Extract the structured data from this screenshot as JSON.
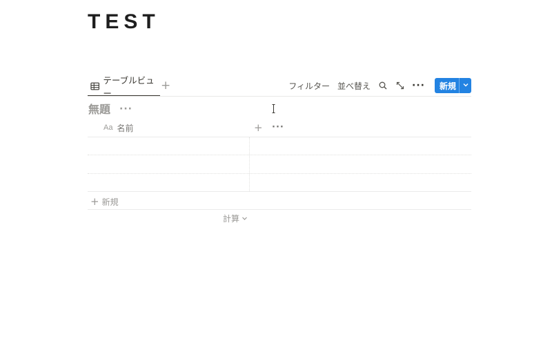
{
  "page": {
    "title": "TEST"
  },
  "view": {
    "tab_label": "テーブルビュー",
    "add_view_symbol": "+",
    "tools": {
      "filter_label": "フィルター",
      "sort_label": "並べ替え",
      "more_symbol": "···",
      "new_button_label": "新規"
    }
  },
  "database": {
    "title": "無題",
    "title_menu_symbol": "···",
    "columns": [
      {
        "type_label": "Aa",
        "name": "名前"
      }
    ],
    "add_column_symbol": "+",
    "column_menu_symbol": "···",
    "rows": [
      {
        "name": ""
      },
      {
        "name": ""
      },
      {
        "name": ""
      }
    ],
    "add_row_symbol": "+",
    "add_row_label": "新規",
    "calculate_label": "計算"
  },
  "colors": {
    "accent": "#2383e2",
    "text_primary": "#37352f",
    "text_muted": "#9b9a97",
    "divider": "#e9e9e7"
  },
  "icons": [
    "table-icon",
    "search-icon",
    "expand-icon",
    "more-icon",
    "chevron-down-icon",
    "text-cursor-icon"
  ]
}
